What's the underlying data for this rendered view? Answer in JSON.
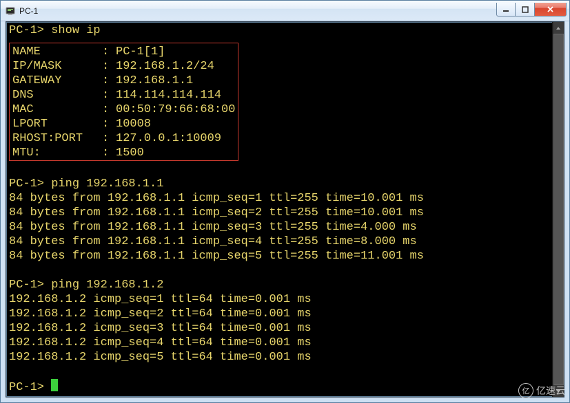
{
  "window": {
    "title": "PC-1"
  },
  "session": {
    "prompt": "PC-1>",
    "cmd_show_ip": "show ip",
    "cmd_ping1": "ping 192.168.1.1",
    "cmd_ping2": "ping 192.168.1.2"
  },
  "ip": {
    "rows": [
      {
        "k": "NAME",
        "v": "PC-1[1]"
      },
      {
        "k": "IP/MASK",
        "v": "192.168.1.2/24"
      },
      {
        "k": "GATEWAY",
        "v": "192.168.1.1"
      },
      {
        "k": "DNS",
        "v": "114.114.114.114"
      },
      {
        "k": "MAC",
        "v": "00:50:79:66:68:00"
      },
      {
        "k": "LPORT",
        "v": "10008"
      },
      {
        "k": "RHOST:PORT",
        "v": "127.0.0.1:10009"
      },
      {
        "k": "MTU:",
        "v": "1500"
      }
    ]
  },
  "ping1": [
    "84 bytes from 192.168.1.1 icmp_seq=1 ttl=255 time=10.001 ms",
    "84 bytes from 192.168.1.1 icmp_seq=2 ttl=255 time=10.001 ms",
    "84 bytes from 192.168.1.1 icmp_seq=3 ttl=255 time=4.000 ms",
    "84 bytes from 192.168.1.1 icmp_seq=4 ttl=255 time=8.000 ms",
    "84 bytes from 192.168.1.1 icmp_seq=5 ttl=255 time=11.001 ms"
  ],
  "ping2": [
    "192.168.1.2 icmp_seq=1 ttl=64 time=0.001 ms",
    "192.168.1.2 icmp_seq=2 ttl=64 time=0.001 ms",
    "192.168.1.2 icmp_seq=3 ttl=64 time=0.001 ms",
    "192.168.1.2 icmp_seq=4 ttl=64 time=0.001 ms",
    "192.168.1.2 icmp_seq=5 ttl=64 time=0.001 ms"
  ],
  "watermark": {
    "text": "亿速云"
  }
}
